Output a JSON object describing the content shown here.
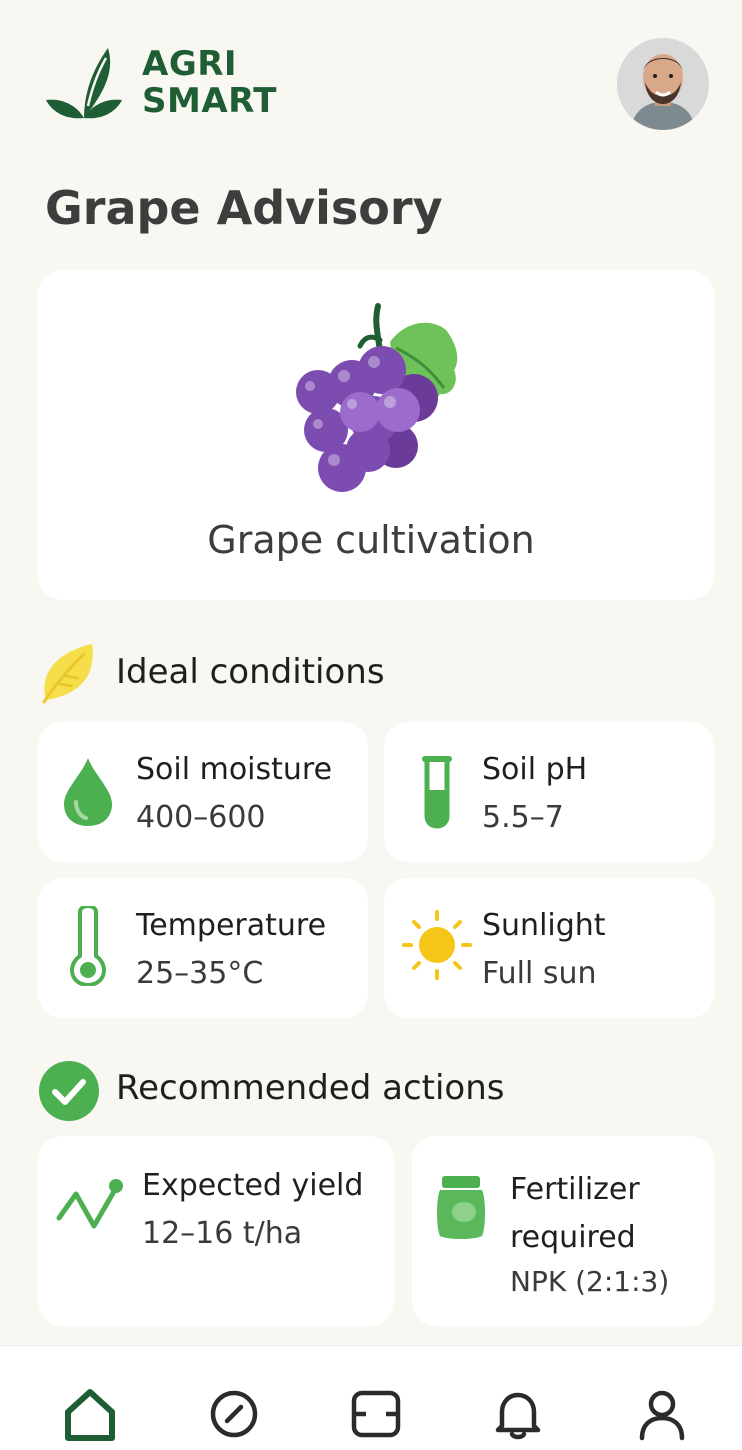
{
  "brand": {
    "name_line1": "AGRI",
    "name_line2": "SMART",
    "brand_color": "#1f5e34"
  },
  "page": {
    "title": "Grape Advisory"
  },
  "hero": {
    "label": "Grape cultivation",
    "icon": "grape-icon"
  },
  "ideal_conditions": {
    "title": "Ideal conditions",
    "icon": "leaf-icon",
    "items": [
      {
        "label": "Soil moisture",
        "value": "400–600",
        "icon": "water-drop-icon"
      },
      {
        "label": "Soil pH",
        "value": "5.5–7",
        "icon": "test-tube-icon"
      },
      {
        "label": "Temperature",
        "value": "25–35°C",
        "icon": "thermometer-icon"
      },
      {
        "label": "Sunlight",
        "value": "Full sun",
        "icon": "sun-icon"
      }
    ]
  },
  "recommended_actions": {
    "title": "Recommended actions",
    "icon": "check-circle-icon",
    "items": [
      {
        "label": "Expected yield",
        "value": "12–16 t/ha",
        "icon": "trend-line-icon"
      },
      {
        "label": "Fertilizer required",
        "value": "NPK (2:1:3)",
        "icon": "fertilizer-bag-icon"
      }
    ]
  },
  "bottom_nav": {
    "items": [
      {
        "icon": "home-icon",
        "active": true
      },
      {
        "icon": "compass-icon",
        "active": false
      },
      {
        "icon": "scanner-icon",
        "active": false
      },
      {
        "icon": "bell-icon",
        "active": false
      },
      {
        "icon": "profile-icon",
        "active": false
      }
    ]
  },
  "colors": {
    "accent_green": "#4caf50",
    "dark_green": "#1f5e34",
    "sun_yellow": "#f5c518",
    "grape_purple": "#7b4aa8",
    "background": "#f8f7f2"
  }
}
